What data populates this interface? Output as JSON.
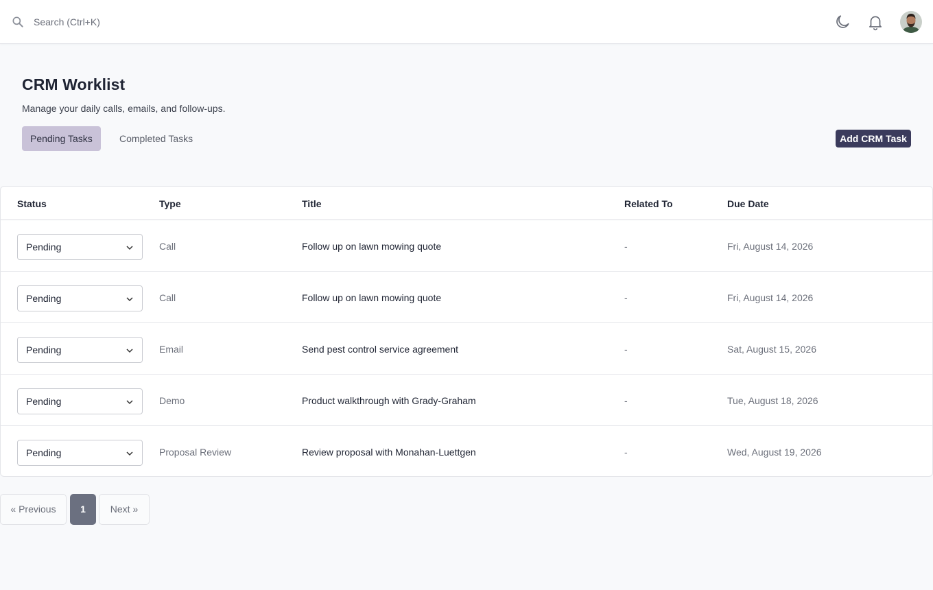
{
  "topbar": {
    "search_placeholder": "Search (Ctrl+K)",
    "icons": [
      "search-icon",
      "moon-icon",
      "bell-icon"
    ]
  },
  "header": {
    "title": "CRM Worklist",
    "subtitle": "Manage your daily calls, emails, and follow-ups.",
    "tabs": [
      {
        "label": "Pending Tasks",
        "active": true
      },
      {
        "label": "Completed Tasks",
        "active": false
      }
    ],
    "add_button_label": "Add CRM Task"
  },
  "table": {
    "columns": [
      "Status",
      "Type",
      "Title",
      "Related To",
      "Due Date"
    ],
    "rows": [
      {
        "status": "Pending",
        "type": "Call",
        "title": "Follow up on lawn mowing quote",
        "related": "-",
        "due": "Fri, August 14, 2026"
      },
      {
        "status": "Pending",
        "type": "Call",
        "title": "Follow up on lawn mowing quote",
        "related": "-",
        "due": "Fri, August 14, 2026"
      },
      {
        "status": "Pending",
        "type": "Email",
        "title": "Send pest control service agreement",
        "related": "-",
        "due": "Sat, August 15, 2026"
      },
      {
        "status": "Pending",
        "type": "Demo",
        "title": "Product walkthrough with Grady-Graham",
        "related": "-",
        "due": "Tue, August 18, 2026"
      },
      {
        "status": "Pending",
        "type": "Proposal Review",
        "title": "Review proposal with Monahan-Luettgen",
        "related": "-",
        "due": "Wed, August 19, 2026"
      }
    ]
  },
  "pagination": {
    "previous_label": "« Previous",
    "current_page": "1",
    "next_label": "Next »"
  },
  "colors": {
    "accent": "#3b3b5c",
    "active_tab": "#c9c2d8",
    "current_page": "#6b7080",
    "background": "#f8f9fb"
  }
}
